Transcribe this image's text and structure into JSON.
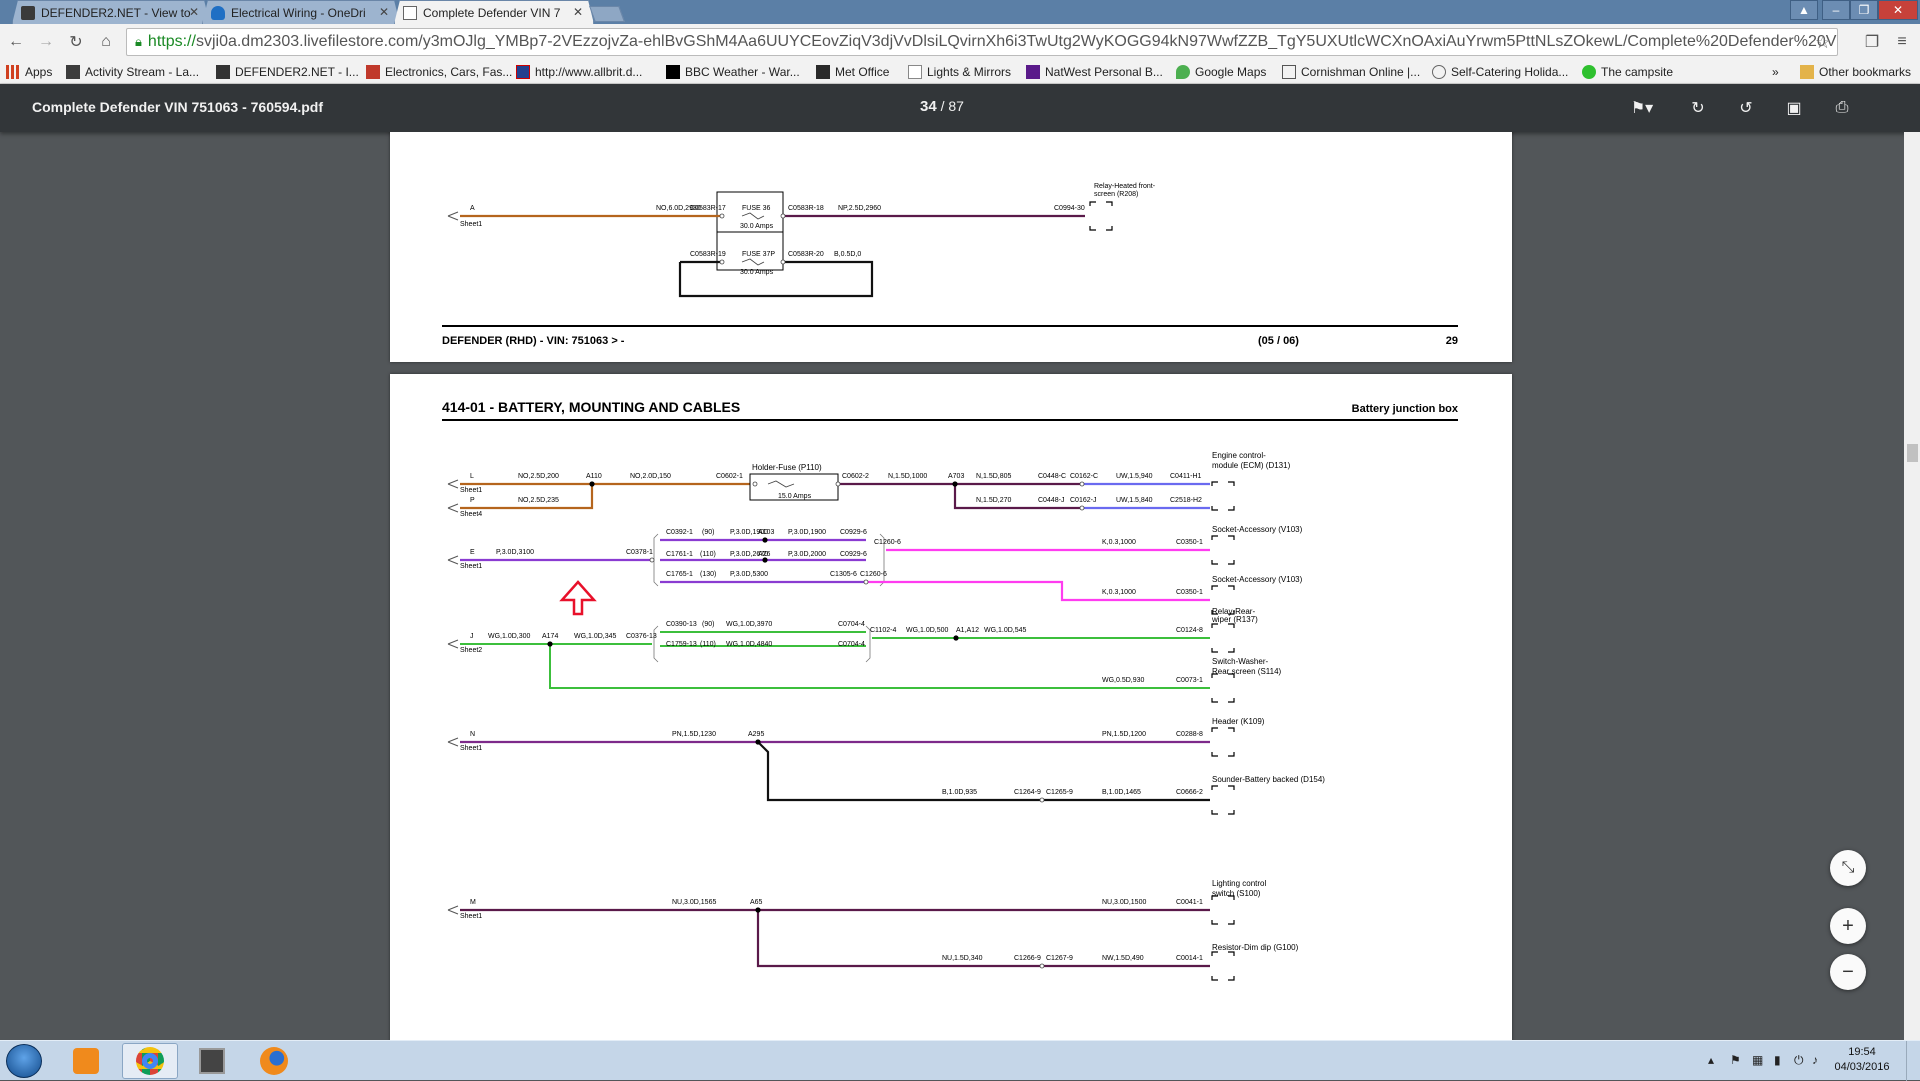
{
  "tabs": [
    {
      "title": "DEFENDER2.NET - View to",
      "icon": "defender-favicon"
    },
    {
      "title": "Electrical Wiring - OneDri",
      "icon": "onedrive-cloud-icon"
    },
    {
      "title": "Complete Defender VIN 7",
      "icon": "document-icon",
      "active": true
    }
  ],
  "address": {
    "scheme": "https://",
    "rest": "svji0a.dm2303.livefilestore.com/y3mOJlg_YMBp7-2VEzzojvZa-ehlBvGShM4Aa6UUYCEovZiqV3djVvDlsiLQvirnXh6i3TwUtg2WyKOGG94kN97WwfZZB_TgY5UXUtlcWCXnOAxiAuYrwm5PttNLsZOkewL/Complete%20Defender%20VIN%20"
  },
  "bookmarks": {
    "items": [
      "Apps",
      "Activity Stream - La...",
      "DEFENDER2.NET - I...",
      "Electronics, Cars, Fas...",
      "http://www.allbrit.d...",
      "BBC Weather - War...",
      "Met Office",
      "Lights & Mirrors",
      "NatWest Personal B...",
      "Google Maps",
      "Cornishman Online |...",
      "Self-Catering Holida...",
      "The campsite"
    ],
    "overflow": "»",
    "other": "Other bookmarks"
  },
  "pdf": {
    "title": "Complete Defender VIN 751063 - 760594.pdf",
    "page_current": "34",
    "page_sep": "/",
    "page_total": "87"
  },
  "page1": {
    "footer_left": "DEFENDER  (RHD) - VIN: 751063 > -",
    "footer_mid": "(05 / 06)",
    "footer_num": "29",
    "labels": {
      "a": "A",
      "sheet": "Sheet1",
      "w1": "NO,6.0D,2980",
      "c17": "C0583R-17",
      "fuse36": "FUSE 36",
      "amps36": "30.0 Amps",
      "c18": "C0583R-18",
      "w2": "NP,2.5D,2960",
      "c0994": "C0994-30",
      "relay1": "Relay-Heated front-",
      "relay2": "screen (R208)",
      "c19": "C0583R-19",
      "fuse37": "FUSE 37P",
      "amps37": "30.0 Amps",
      "c20": "C0583R-20",
      "w3": "B,0.5D,0"
    }
  },
  "page2": {
    "header_left": "414-01 - BATTERY, MOUNTING AND CABLES",
    "header_right": "Battery junction box",
    "labels": {
      "L": "L",
      "P": "P",
      "sheet1": "Sheet1",
      "sheet4": "Sheet4",
      "no25": "NO,2.5D,200",
      "a110": "A110",
      "no20": "NO,2.0D,150",
      "c0602_1": "C0602-1",
      "holder": "Holder-Fuse (P110)",
      "amps15": "15.0 Amps",
      "c0602_2": "C0602-2",
      "n15_1000": "N,1.5D,1000",
      "a703": "A703",
      "n15_805": "N,1.5D,805",
      "c0448c": "C0448-C",
      "c0162c": "C0162-C",
      "uw940": "UW,1.5,940",
      "c0411": "C0411-H1",
      "ecm1": "Engine control-",
      "ecm2": "module (ECM) (D131)",
      "no25_235": "NO,2.5D,235",
      "n15_270": "N,1.5D,270",
      "c0448j": "C0448-J",
      "c0162j": "C0162-J",
      "uw840": "UW,1.5,840",
      "c2518": "C2518-H2",
      "E": "E",
      "p30_3100": "P,3.0D,3100",
      "c0378": "C0378-1",
      "c0392": "C0392-1",
      "n90a": "(90)",
      "p30_1900a": "P,3.0D,1900",
      "a103": "A103",
      "p30_1900b": "P,3.0D,1900",
      "c0929a": "C0929-6",
      "c1260a": "C1260-6",
      "k03_1000a": "K,0.3,1000",
      "c0350a": "C0350-1",
      "sock1": "Socket-Accessory (V103)",
      "c1761": "C1761-1",
      "n110a": "(110)",
      "p30_2670": "P,3.0D,2670",
      "a26": "A26",
      "p30_2000": "P,3.0D,2000",
      "c0929b": "C0929-6",
      "c1765": "C1765-1",
      "n130": "(130)",
      "p30_5300": "P,3.0D,5300",
      "c1305": "C1305-6",
      "c1260b": "C1260-6",
      "k03_1000b": "K,0.3,1000",
      "c0350b": "C0350-1",
      "sock2": "Socket-Accessory (V103)",
      "J": "J",
      "sheet2": "Sheet2",
      "wg300": "WG,1.0D,300",
      "a174": "A174",
      "wg345": "WG,1.0D,345",
      "c0376": "C0376-13",
      "c0390": "C0390-13",
      "n90b": "(90)",
      "wg3970": "WG,1.0D,3970",
      "c0704a": "C0704-4",
      "c1102": "C1102-4",
      "wg500": "WG,1.0D,500",
      "a1a12": "A1,A12",
      "wg545": "WG,1.0D,545",
      "c0124": "C0124-8",
      "relayrw1": "Relay-Rear-",
      "relayrw2": "wiper (R137)",
      "c1759": "C1759-13",
      "n110b": "(110)",
      "wg4840": "WG,1.0D,4840",
      "c0704b": "C0704-4",
      "wg930": "WG,0.5D,930",
      "c0073": "C0073-1",
      "sw1": "Switch-Washer-",
      "sw2": "Rear screen (S114)",
      "N": "N",
      "pn1230": "PN,1.5D,1230",
      "a295": "A295",
      "pn1200": "PN,1.5D,1200",
      "c0288": "C0288-8",
      "header": "Header (K109)",
      "b935": "B,1.0D,935",
      "c1264": "C1264-9",
      "c1265": "C1265-9",
      "b1465": "B,1.0D,1465",
      "c0666": "C0666-2",
      "sounder": "Sounder-Battery backed (D154)",
      "M": "M",
      "nu1565": "NU,3.0D,1565",
      "a65": "A65",
      "nu1500": "NU,3.0D,1500",
      "c0041": "C0041-1",
      "light1": "Lighting control",
      "light2": "switch (S100)",
      "nu340": "NU,1.5D,340",
      "c1266": "C1266-9",
      "c1267": "C1267-9",
      "nw490": "NW,1.5D,490",
      "c0014": "C0014-1",
      "resistor": "Resistor-Dim dip (G100)"
    }
  },
  "clock": {
    "time": "19:54",
    "date": "04/03/2016"
  },
  "colors": {
    "orange": "#b5651d",
    "purple": "#8a3bd1",
    "magenta": "#ff3cf0",
    "green": "#3cbf3c",
    "violet": "#7d2a8a",
    "black": "#111111",
    "brown": "#5a1a4a",
    "blue": "#6a6af0",
    "red_arrow": "#e8102a"
  }
}
